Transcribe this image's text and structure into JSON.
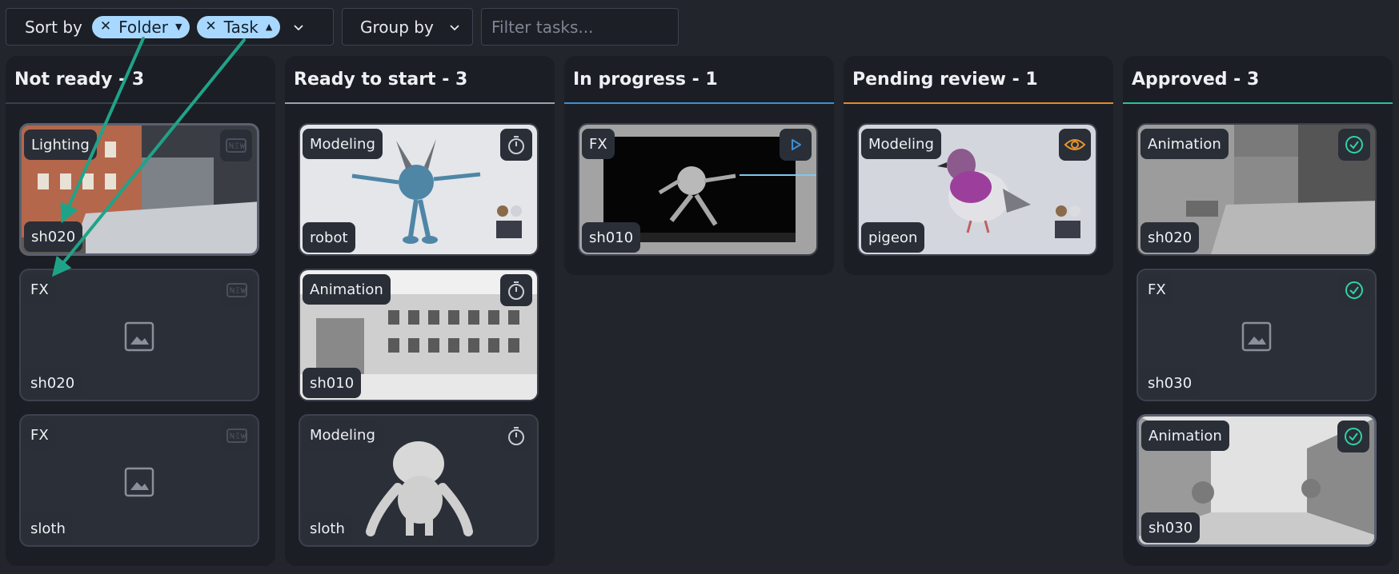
{
  "toolbar": {
    "sort_label": "Sort by",
    "sort_chips": [
      {
        "label": "Folder",
        "direction": "desc"
      },
      {
        "label": "Task",
        "direction": "asc"
      }
    ],
    "group_label": "Group by",
    "filter_placeholder": "Filter tasks..."
  },
  "columns": [
    {
      "title": "Not ready - 3",
      "accent": "#3b3f4a",
      "cards": [
        {
          "task": "Lighting",
          "folder": "sh020",
          "thumb": "building-street",
          "status_icon": "new-icon",
          "status_color": "#4b505c"
        },
        {
          "task": "FX",
          "folder": "sh020",
          "thumb": "placeholder",
          "status_icon": "new-icon",
          "status_color": "#4b505c"
        },
        {
          "task": "FX",
          "folder": "sloth",
          "thumb": "placeholder",
          "status_icon": "new-icon",
          "status_color": "#4b505c"
        }
      ]
    },
    {
      "title": "Ready to start - 3",
      "accent": "#9aa0ad",
      "cards": [
        {
          "task": "Modeling",
          "folder": "robot",
          "thumb": "robot-model",
          "status_icon": "timer-icon",
          "status_color": "#c9ccd4"
        },
        {
          "task": "Animation",
          "folder": "sh010",
          "thumb": "building-facade",
          "status_icon": "timer-icon",
          "status_color": "#c9ccd4"
        },
        {
          "task": "Modeling",
          "folder": "sloth",
          "thumb": "sloth-model",
          "status_icon": "timer-icon",
          "status_color": "#c9ccd4"
        }
      ]
    },
    {
      "title": "In progress - 1",
      "accent": "#3d8fd4",
      "cards": [
        {
          "task": "FX",
          "folder": "sh010",
          "thumb": "robot-render",
          "status_icon": "play-icon",
          "status_color": "#3d8fd4"
        }
      ]
    },
    {
      "title": "Pending review - 1",
      "accent": "#e08a2c",
      "cards": [
        {
          "task": "Modeling",
          "folder": "pigeon",
          "thumb": "pigeon-model",
          "status_icon": "eye-icon",
          "status_color": "#e8942e"
        }
      ]
    },
    {
      "title": "Approved - 3",
      "accent": "#27c39a",
      "cards": [
        {
          "task": "Animation",
          "folder": "sh020",
          "thumb": "street-gray",
          "status_icon": "check-circle-icon",
          "status_color": "#2fd3a4"
        },
        {
          "task": "FX",
          "folder": "sh030",
          "thumb": "placeholder",
          "status_icon": "check-circle-icon",
          "status_color": "#2fd3a4"
        },
        {
          "task": "Animation",
          "folder": "sh030",
          "thumb": "street-wide",
          "status_icon": "check-circle-icon",
          "status_color": "#2fd3a4"
        }
      ]
    }
  ],
  "annotation": {
    "arrow_color": "#1fa388"
  }
}
